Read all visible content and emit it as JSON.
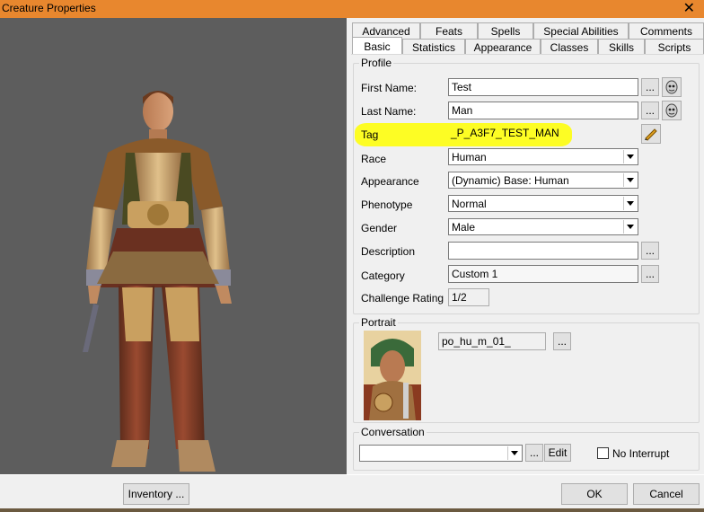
{
  "window": {
    "title": "Creature Properties",
    "close_glyph": "✕"
  },
  "tabs": {
    "row_top": [
      "Advanced",
      "Feats",
      "Spells",
      "Special Abilities",
      "Comments"
    ],
    "row_bottom": [
      "Basic",
      "Statistics",
      "Appearance",
      "Classes",
      "Skills",
      "Scripts"
    ],
    "active": "Basic"
  },
  "profile": {
    "legend": "Profile",
    "first_name": {
      "label": "First Name:",
      "value": "Test"
    },
    "last_name": {
      "label": "Last Name:",
      "value": "Man"
    },
    "tag": {
      "label": "Tag",
      "value": "_P_A3F7_TEST_MAN"
    },
    "race": {
      "label": "Race",
      "value": "Human"
    },
    "appearance": {
      "label": "Appearance",
      "value": "(Dynamic) Base: Human"
    },
    "phenotype": {
      "label": "Phenotype",
      "value": "Normal"
    },
    "gender": {
      "label": "Gender",
      "value": "Male"
    },
    "description": {
      "label": "Description",
      "value": ""
    },
    "category": {
      "label": "Category",
      "value": "Custom 1"
    },
    "challenge_rating": {
      "label": "Challenge Rating",
      "value": "1/2"
    },
    "ellipsis": "..."
  },
  "portrait": {
    "legend": "Portrait",
    "value": "po_hu_m_01_",
    "ellipsis": "..."
  },
  "conversation": {
    "legend": "Conversation",
    "value": "",
    "ellipsis": "...",
    "edit_label": "Edit",
    "no_interrupt_label": "No Interrupt",
    "no_interrupt_checked": false
  },
  "footer": {
    "inventory_label": "Inventory ...",
    "ok_label": "OK",
    "cancel_label": "Cancel"
  },
  "colors": {
    "titlebar": "#e8872e",
    "highlight": "#ffff00",
    "viewport": "#5d5d5d"
  }
}
